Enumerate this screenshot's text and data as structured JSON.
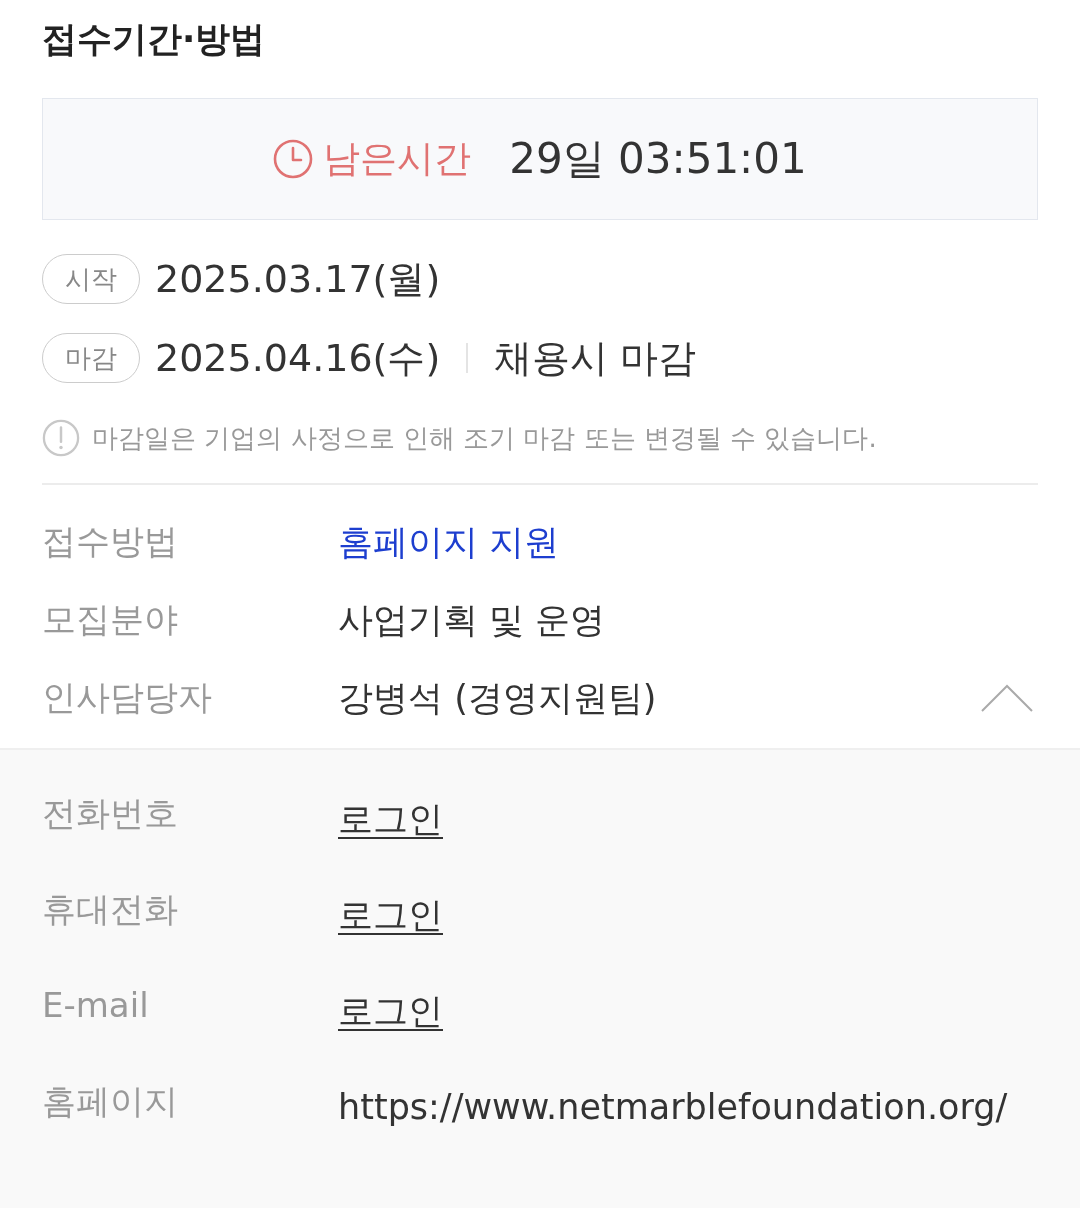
{
  "section": {
    "title": "접수기간·방법"
  },
  "countdown": {
    "label": "남은시간",
    "value": "29일 03:51:01"
  },
  "dates": [
    {
      "tag": "시작",
      "date": "2025.03.17(월)"
    },
    {
      "tag": "마감",
      "date": "2025.04.16(수)",
      "note": "채용시 마감"
    }
  ],
  "notice": "마감일은 기업의 사정으로 인해 조기 마감 또는 변경될 수 있습니다.",
  "info": [
    {
      "label": "접수방법",
      "value": "홈페이지 지원",
      "kind": "link"
    },
    {
      "label": "모집분야",
      "value": "사업기획 및 운영",
      "kind": "text"
    },
    {
      "label": "인사담당자",
      "value": "강병석 (경영지원팀)",
      "kind": "text"
    }
  ],
  "details": {
    "expanded": true,
    "rows": [
      {
        "label": "전화번호",
        "value": "로그인",
        "kind": "login"
      },
      {
        "label": "휴대전화",
        "value": "로그인",
        "kind": "login"
      },
      {
        "label": "E-mail",
        "value": "로그인",
        "kind": "login"
      },
      {
        "label": "홈페이지",
        "value": "https://www.netmarblefoundation.org/",
        "kind": "text"
      }
    ]
  }
}
